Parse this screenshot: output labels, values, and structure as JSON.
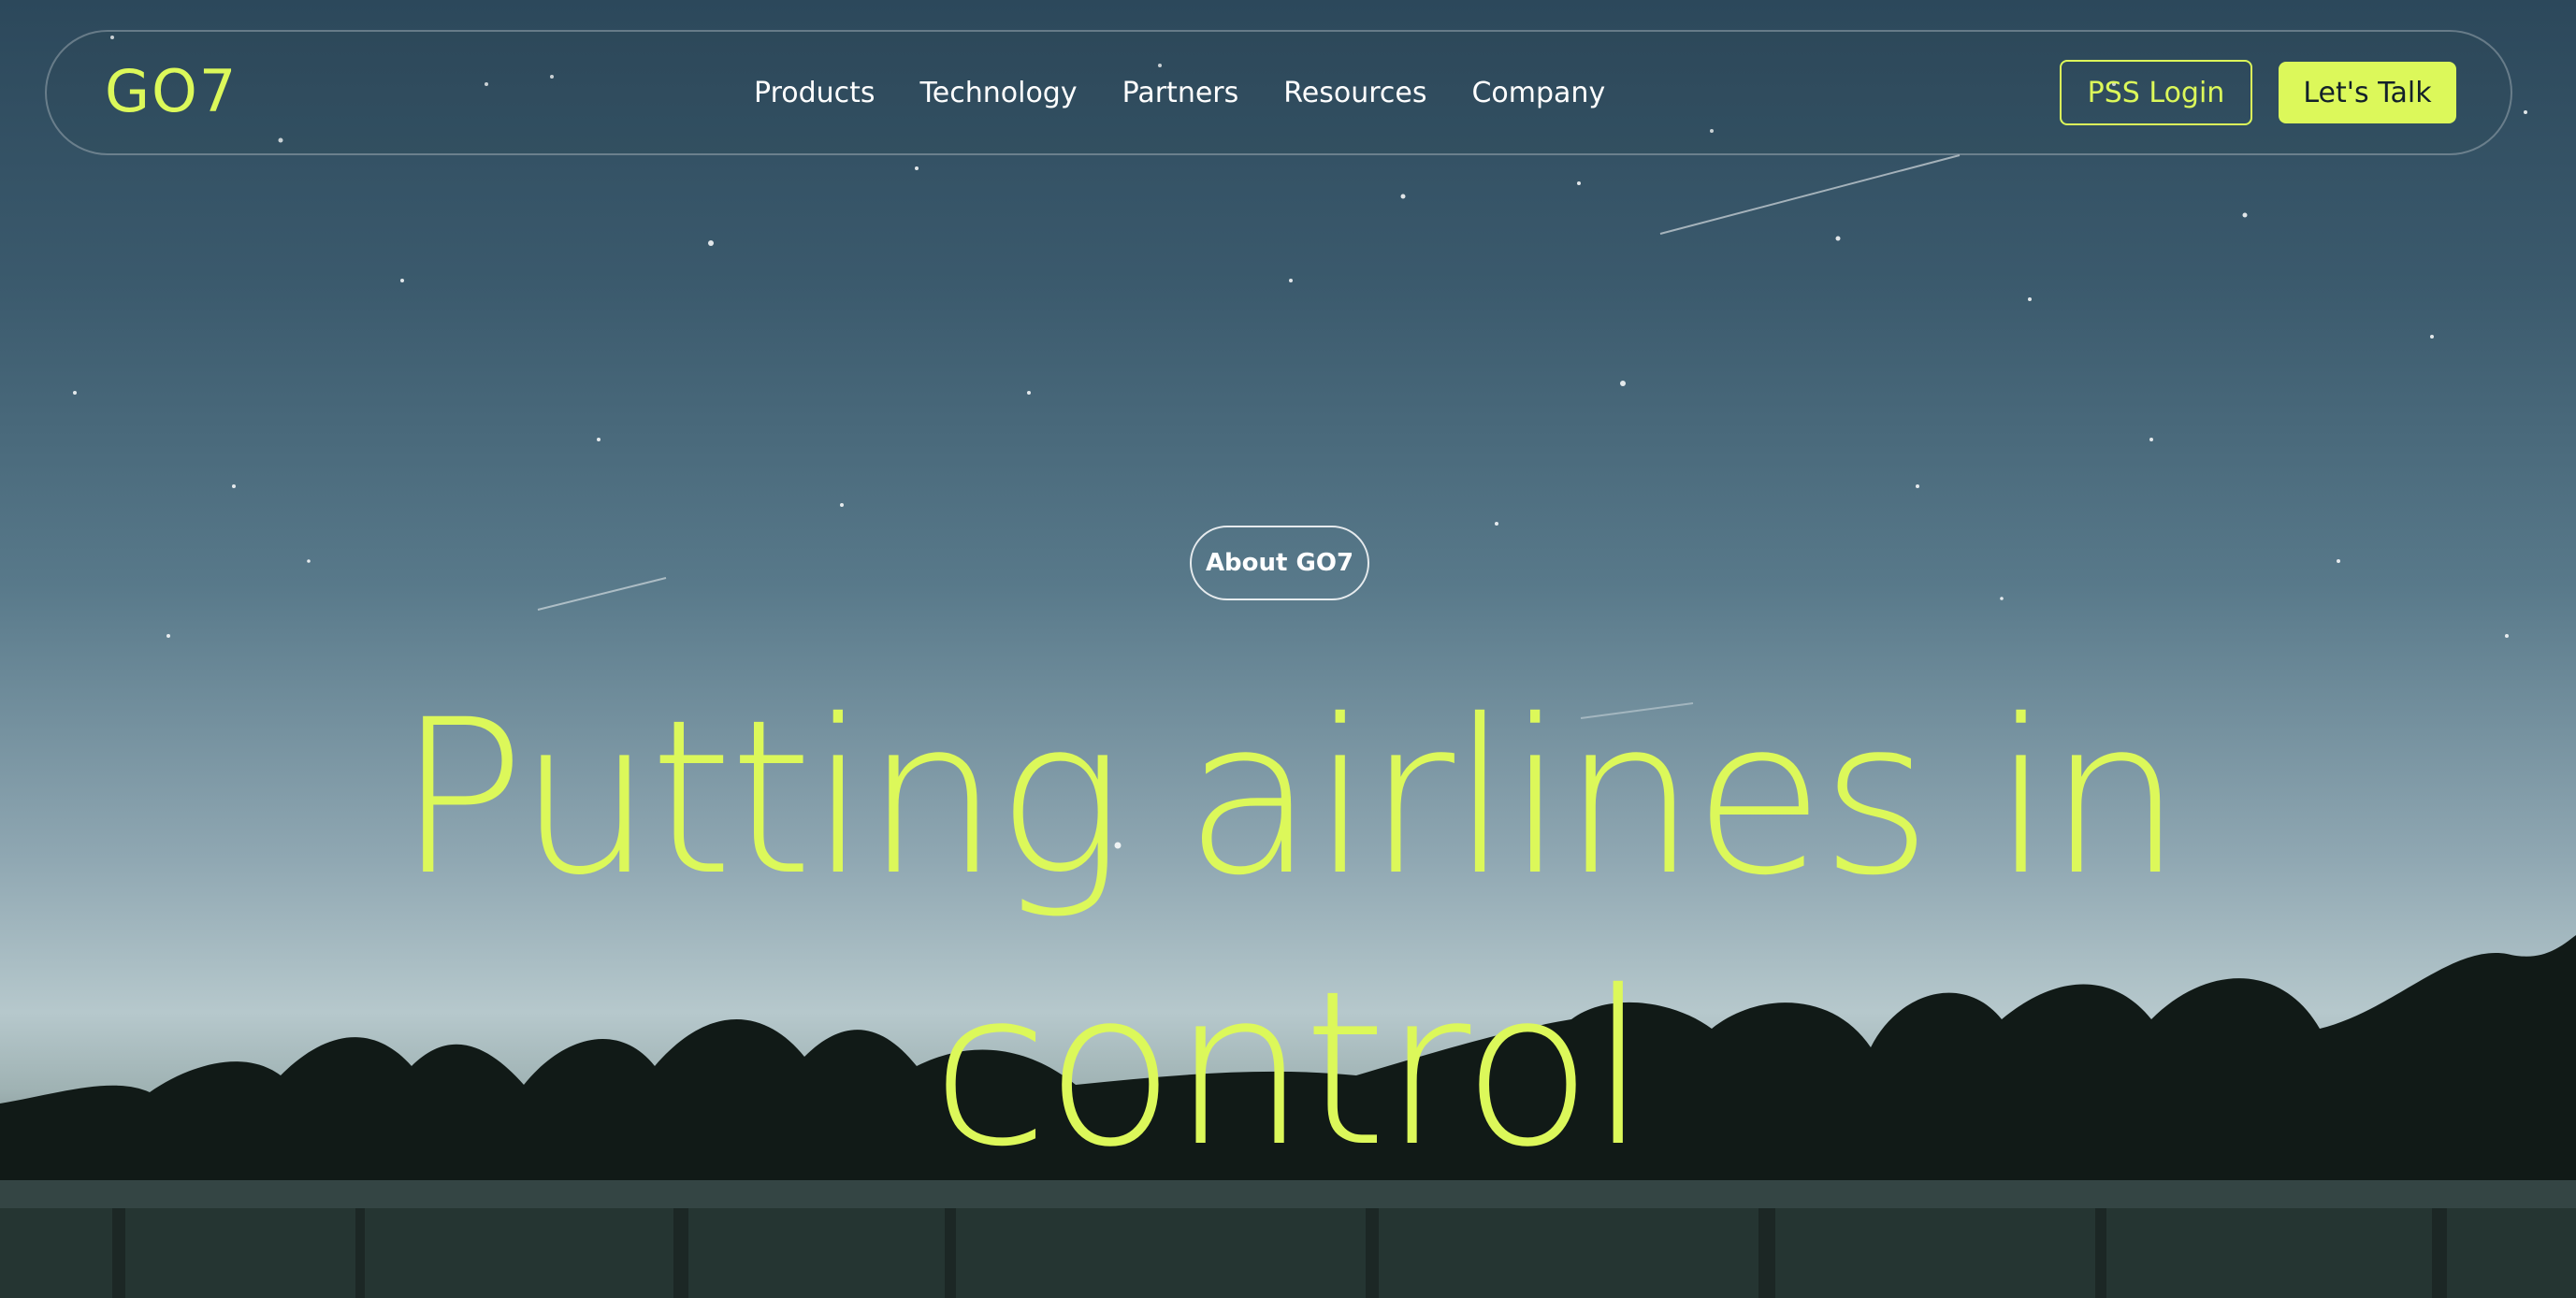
{
  "brand": {
    "logo_text": "GO7",
    "accent_color": "#dcf85a"
  },
  "nav": {
    "items": [
      {
        "label": "Products"
      },
      {
        "label": "Technology"
      },
      {
        "label": "Partners"
      },
      {
        "label": "Resources"
      },
      {
        "label": "Company"
      }
    ],
    "login_label": "PSS Login",
    "cta_label": "Let's Talk"
  },
  "hero": {
    "eyebrow_label": "About GO7",
    "headline_line1": "Putting airlines in",
    "headline_line2": "control",
    "background": "night-sky-lake-photo"
  }
}
